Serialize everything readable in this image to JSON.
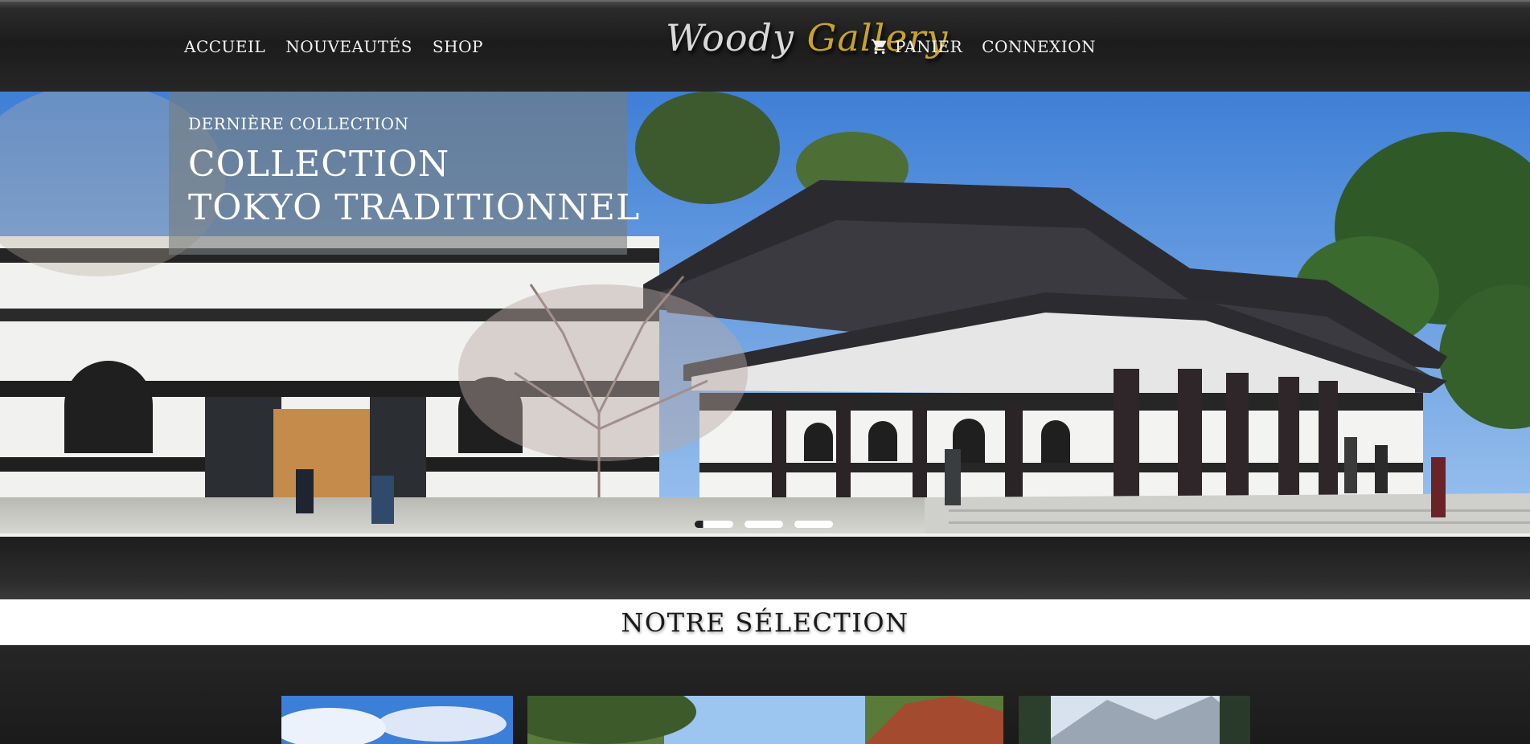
{
  "header": {
    "nav_left": [
      {
        "label": "ACCUEIL"
      },
      {
        "label": "NOUVEAUTÉS"
      },
      {
        "label": "SHOP"
      }
    ],
    "logo": {
      "word1": "Woody",
      "word2": "Gallery"
    },
    "nav_right": {
      "cart_label": "PANIER",
      "cart_icon": "shopping-cart-icon",
      "login_label": "CONNEXION"
    }
  },
  "hero": {
    "kicker": "DERNIÈRE COLLECTION",
    "title_line1": "COLLECTION",
    "title_line2": "TOKYO TRADITIONNEL",
    "slides_count": 3,
    "active_slide": 1
  },
  "selection": {
    "title": "NOTRE SÉLECTION"
  },
  "colors": {
    "logo_gold": "#c9a227",
    "logo_silver": "#d8d8d8",
    "header_bg": "#1c1c1c"
  }
}
